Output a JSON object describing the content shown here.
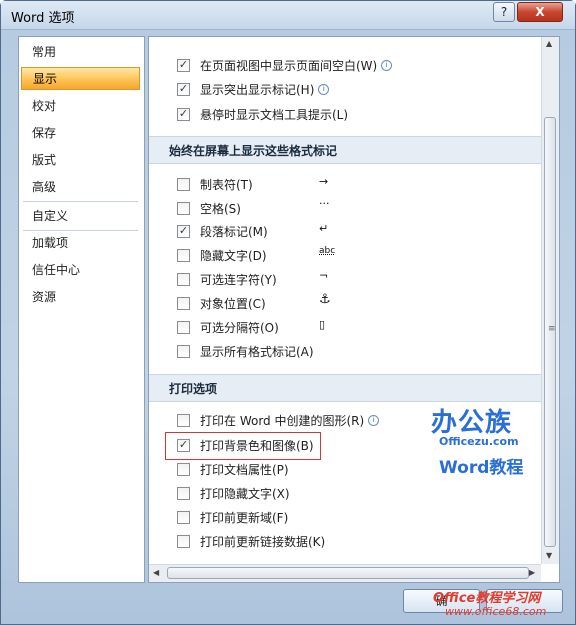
{
  "window": {
    "title": "Word 选项",
    "help_label": "?",
    "close_label": "X",
    "ok_label": "确",
    "cancel_label": ""
  },
  "nav": {
    "items": [
      {
        "label": "常用"
      },
      {
        "label": "显示",
        "active": true
      },
      {
        "label": "校对"
      },
      {
        "label": "保存"
      },
      {
        "label": "版式"
      },
      {
        "label": "高级"
      },
      {
        "label": "自定义"
      },
      {
        "label": "加载项"
      },
      {
        "label": "信任中心"
      },
      {
        "label": "资源"
      }
    ]
  },
  "page_options": [
    {
      "label": "在页面视图中显示页面间空白(W)",
      "checked": true,
      "info": true
    },
    {
      "label": "显示突出显示标记(H)",
      "checked": true,
      "info": true
    },
    {
      "label": "悬停时显示文档工具提示(L)",
      "checked": true
    }
  ],
  "format_marks": {
    "title": "始终在屏幕上显示这些格式标记",
    "items": [
      {
        "label": "制表符(T)",
        "checked": false,
        "symbol": "→"
      },
      {
        "label": "空格(S)",
        "checked": false,
        "symbol": "···"
      },
      {
        "label": "段落标记(M)",
        "checked": true,
        "symbol": "↵"
      },
      {
        "label": "隐藏文字(D)",
        "checked": false,
        "symbol": "abc"
      },
      {
        "label": "可选连字符(Y)",
        "checked": false,
        "symbol": "¬"
      },
      {
        "label": "对象位置(C)",
        "checked": false,
        "symbol": "⚓"
      },
      {
        "label": "可选分隔符(O)",
        "checked": false,
        "symbol": "▯"
      },
      {
        "label": "显示所有格式标记(A)",
        "checked": false,
        "symbol": ""
      }
    ]
  },
  "print_options": {
    "title": "打印选项",
    "items": [
      {
        "label": "打印在 Word 中创建的图形(R)",
        "checked": false,
        "info": true
      },
      {
        "label": "打印背景色和图像(B)",
        "checked": true
      },
      {
        "label": "打印文档属性(P)",
        "checked": false
      },
      {
        "label": "打印隐藏文字(X)",
        "checked": false
      },
      {
        "label": "打印前更新域(F)",
        "checked": false
      },
      {
        "label": "打印前更新链接数据(K)",
        "checked": false
      }
    ]
  },
  "watermarks": {
    "logo_big": "办公族",
    "logo_site": "Officezu.com",
    "logo_word": "Word教程",
    "site_line1": "Office教程学习网",
    "site_line2": "www.office68.com"
  }
}
